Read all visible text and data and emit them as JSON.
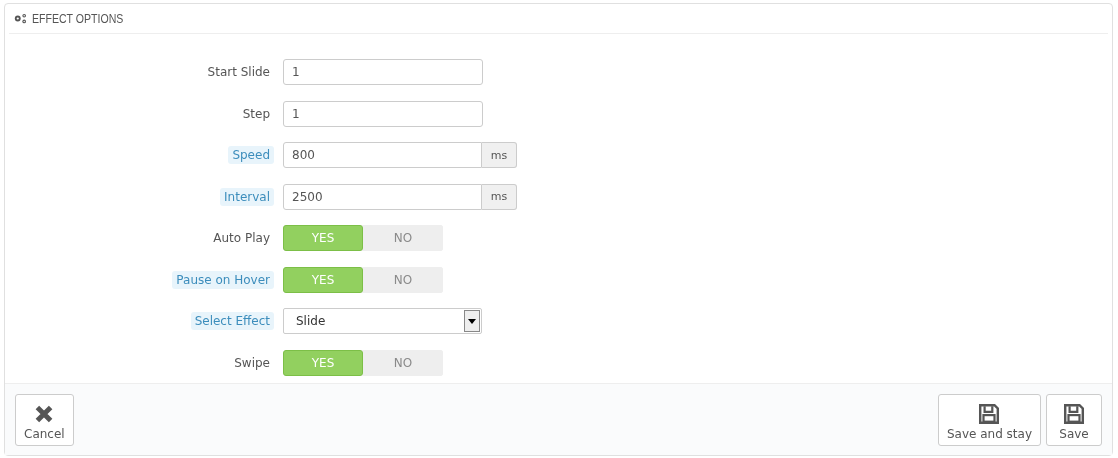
{
  "panel": {
    "title": "EFFECT OPTIONS"
  },
  "fields": [
    {
      "kind": "text",
      "label": "Start Slide",
      "hint": false,
      "value": "1"
    },
    {
      "kind": "text",
      "label": "Step",
      "hint": false,
      "value": "1"
    },
    {
      "kind": "addon",
      "label": "Speed",
      "hint": true,
      "value": "800",
      "addon": "ms"
    },
    {
      "kind": "addon",
      "label": "Interval",
      "hint": true,
      "value": "2500",
      "addon": "ms"
    },
    {
      "kind": "toggle",
      "label": "Auto Play",
      "hint": false,
      "on": true,
      "yes": "YES",
      "no": "NO"
    },
    {
      "kind": "toggle",
      "label": "Pause on Hover",
      "hint": true,
      "on": true,
      "yes": "YES",
      "no": "NO"
    },
    {
      "kind": "select",
      "label": "Select Effect",
      "hint": true,
      "value": "Slide"
    },
    {
      "kind": "toggle",
      "label": "Swipe",
      "hint": false,
      "on": true,
      "yes": "YES",
      "no": "NO"
    }
  ],
  "footer": {
    "left": [
      {
        "kind": "cancel",
        "label": "Cancel"
      }
    ],
    "right": [
      {
        "kind": "save",
        "label": "Save and stay"
      },
      {
        "kind": "save",
        "label": "Save"
      }
    ]
  }
}
